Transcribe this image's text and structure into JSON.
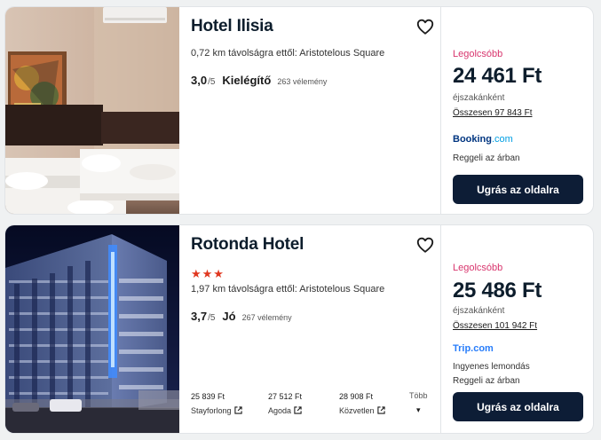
{
  "results": [
    {
      "name": "Hotel Ilisia",
      "distance": "0,72 km távolságra ettől: Aristotelous Square",
      "rating_score": "3,0",
      "rating_max": "/5",
      "rating_label": "Kielégítő",
      "rating_count": "263 vélemény",
      "cheapest_label": "Legolcsóbb",
      "price": "24 461 Ft",
      "per_night": "éjszakánként",
      "total": "Összesen 97 843 Ft",
      "provider_part1": "Booking",
      "provider_part2": ".com",
      "perks": [
        "Reggeli az árban"
      ],
      "cta": "Ugrás az oldalra"
    },
    {
      "name": "Rotonda Hotel",
      "stars": 3,
      "stars_text": "★★★",
      "distance": "1,97 km távolságra ettől: Aristotelous Square",
      "rating_score": "3,7",
      "rating_max": "/5",
      "rating_label": "Jó",
      "rating_count": "267 vélemény",
      "cheapest_label": "Legolcsóbb",
      "price": "25 486 Ft",
      "per_night": "éjszakánként",
      "total": "Összesen 101 942 Ft",
      "provider": "Trip.com",
      "perks": [
        "Ingyenes lemondás",
        "Reggeli az árban"
      ],
      "cta": "Ugrás az oldalra",
      "other_offers": [
        {
          "price": "25 839 Ft",
          "site": "Stayforlong"
        },
        {
          "price": "27 512 Ft",
          "site": "Agoda"
        },
        {
          "price": "28 908 Ft",
          "site": "Közvetlen"
        }
      ],
      "more_label": "Több",
      "more_icon": "▾"
    }
  ],
  "colors": {
    "cheapest": "#d8356d",
    "cta_bg": "#0d1d36",
    "stars": "#e0371f",
    "booking_blue": "#003580",
    "booking_light": "#009fe3",
    "trip_blue": "#287dfa"
  }
}
